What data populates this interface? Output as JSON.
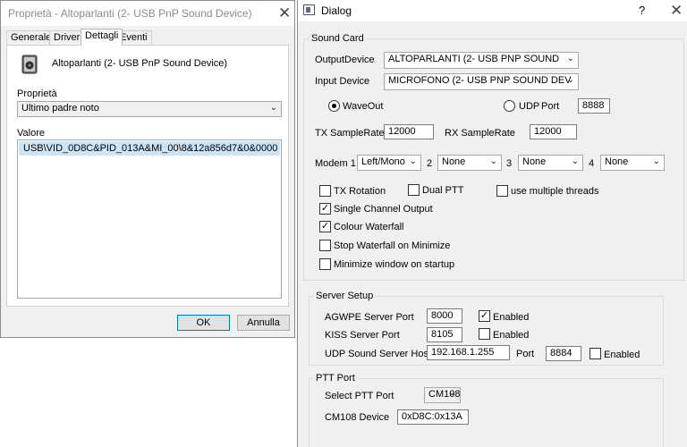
{
  "properties_window": {
    "title": "Proprietà - Altoparlanti (2- USB PnP Sound Device)",
    "close_glyph": "✕",
    "tabs": [
      "Generale",
      "Driver",
      "Dettagli",
      "Eventi"
    ],
    "active_tab": "Dettagli",
    "device_name": "Altoparlanti (2- USB PnP Sound Device)",
    "device_icon": "speaker-icon",
    "property_label": "Proprietà",
    "property_value": "Ultimo padre noto",
    "value_label": "Valore",
    "value_entry": "USB\\VID_0D8C&PID_013A&MI_00\\8&12a856d7&0&0000",
    "ok_label": "OK",
    "cancel_label": "Annulla"
  },
  "dialog": {
    "title": "Dialog",
    "help_glyph": "?",
    "close_glyph": "✕",
    "sound_card": {
      "group_label": "Sound Card",
      "output_label": "OutputDevice",
      "output_value": "ALTOPARLANTI (2- USB PNP SOUND",
      "input_label": "Input Device",
      "input_value": "MICROFONO (2- USB PNP SOUND DEV",
      "waveout_label": "WaveOut",
      "waveout_selected": true,
      "udp_label": "UDP",
      "udp_selected": false,
      "port_label": "Port",
      "port_value": "8888",
      "tx_samplerate_label": "TX SampleRate",
      "tx_samplerate_value": "12000",
      "rx_samplerate_label": "RX SampleRate",
      "rx_samplerate_value": "12000",
      "modem1_label": "Modem 1",
      "modem1_value": "Left/Mono",
      "modem2_label": "2",
      "modem2_value": "None",
      "modem3_label": "3",
      "modem3_value": "None",
      "modem4_label": "4",
      "modem4_value": "None",
      "tx_rotation": {
        "label": "TX Rotation",
        "checked": false
      },
      "dual_ptt": {
        "label": "Dual PTT",
        "checked": false
      },
      "multi_threads": {
        "label": "use multiple threads",
        "checked": false
      },
      "single_channel": {
        "label": "Single Channel Output",
        "checked": true
      },
      "colour_waterfall": {
        "label": "Colour Waterfall",
        "checked": true
      },
      "stop_waterfall": {
        "label": "Stop Waterfall on Minimize",
        "checked": false
      },
      "minimize_startup": {
        "label": "Minimize window on startup",
        "checked": false
      }
    },
    "server_setup": {
      "group_label": "Server Setup",
      "agwpe_label": "AGWPE Server Port",
      "agwpe_value": "8000",
      "agwpe_enabled": {
        "label": "Enabled",
        "checked": true
      },
      "kiss_label": "KISS Server Port",
      "kiss_value": "8105",
      "kiss_enabled": {
        "label": "Enabled",
        "checked": false
      },
      "udp_host_label": "UDP Sound Server Host",
      "udp_host_value": "192.168.1.255",
      "udp_port_label": "Port",
      "udp_port_value": "8884",
      "udp_enabled": {
        "label": "Enabled",
        "checked": false
      }
    },
    "ptt_port": {
      "group_label": "PTT Port",
      "select_label": "Select PTT Port",
      "select_value": "CM108",
      "cm108_label": "CM108 Device",
      "cm108_value": "0xD8C:0x13A"
    }
  }
}
